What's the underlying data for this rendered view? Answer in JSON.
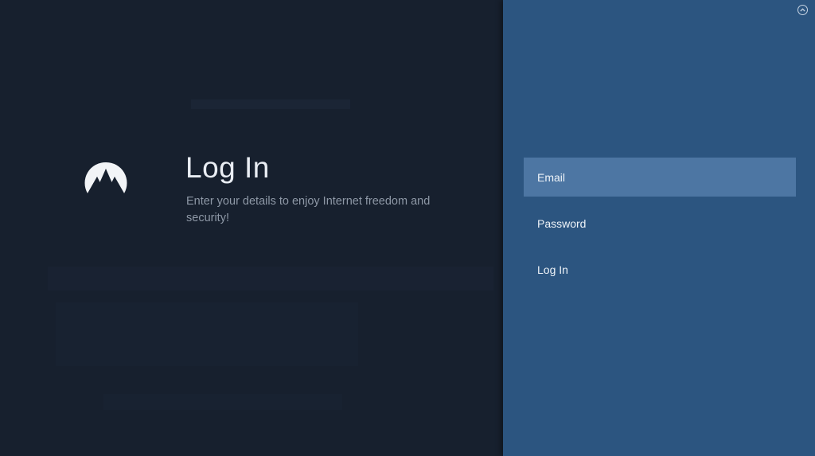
{
  "login": {
    "title": "Log In",
    "subtitle": "Enter your details to enjoy Internet freedom and security!"
  },
  "menu": {
    "items": [
      {
        "label": "Email",
        "active": true
      },
      {
        "label": "Password",
        "active": false
      },
      {
        "label": "Log In",
        "active": false
      }
    ]
  },
  "icons": {
    "logo": "nordvpn-mountain-logo",
    "collapse": "chevron-up-circle-icon"
  },
  "colors": {
    "left_background": "#17202e",
    "right_background": "#2c5580",
    "selected_item": "#4d76a3"
  }
}
